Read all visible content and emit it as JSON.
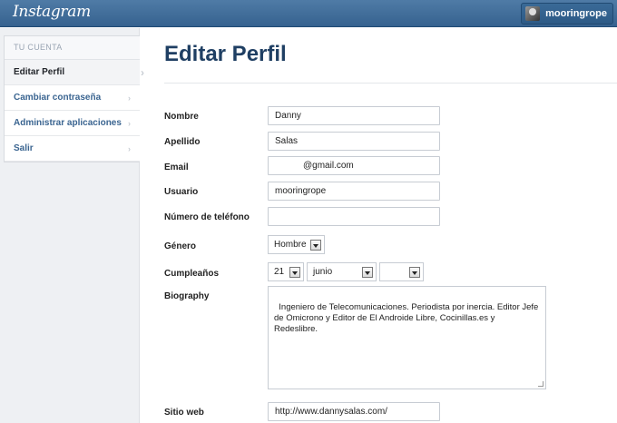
{
  "header": {
    "logo": "Instagram",
    "username": "mooringrope"
  },
  "sidebar": {
    "heading": "TU CUENTA",
    "items": [
      {
        "label": "Editar Perfil"
      },
      {
        "label": "Cambiar contraseña"
      },
      {
        "label": "Administrar aplicaciones"
      },
      {
        "label": "Salir"
      }
    ]
  },
  "page": {
    "title": "Editar Perfil"
  },
  "form": {
    "nombre": {
      "label": "Nombre",
      "value": "Danny"
    },
    "apellido": {
      "label": "Apellido",
      "value": "Salas"
    },
    "email": {
      "label": "Email",
      "value": "@gmail.com"
    },
    "usuario": {
      "label": "Usuario",
      "value": "mooringrope"
    },
    "telefono": {
      "label": "Número de teléfono",
      "value": ""
    },
    "genero": {
      "label": "Género",
      "value": "Hombre"
    },
    "cumpleanos": {
      "label": "Cumpleaños",
      "day": "21",
      "month": "junio",
      "year": ""
    },
    "biography": {
      "label": "Biography",
      "value": "Ingeniero de Telecomunicaciones. Periodista por inercia. Editor Jefe de Omicrono y Editor de El Androide Libre, Cocinillas.es y Redeslibre."
    },
    "sitio_web": {
      "label": "Sitio web",
      "value": "http://www.dannysalas.com/"
    }
  }
}
